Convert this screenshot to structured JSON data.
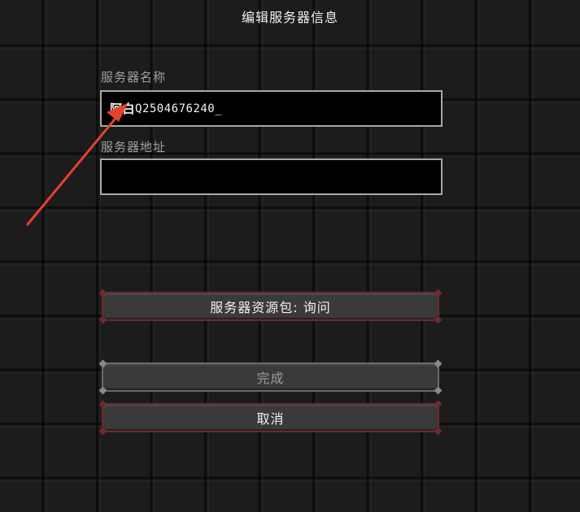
{
  "screen": {
    "title": "编辑服务器信息"
  },
  "form": {
    "name_label": "服务器名称",
    "name_value_cjk": "阿白",
    "name_value_rest": "Q2504676240_",
    "address_label": "服务器地址",
    "address_value": ""
  },
  "buttons": {
    "resource_pack": "服务器资源包: 询问",
    "done": "完成",
    "cancel": "取消"
  },
  "annotation": {
    "arrow_color": "#e8412c"
  }
}
